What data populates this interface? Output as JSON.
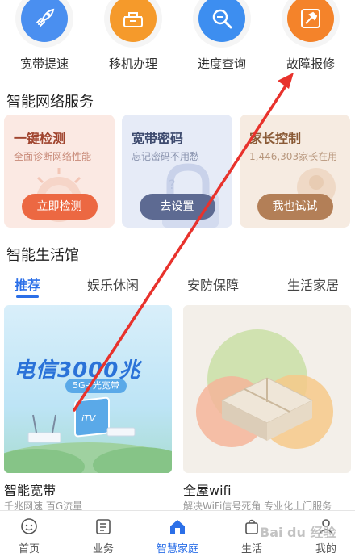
{
  "quick_actions": [
    {
      "label": "宽带提速",
      "icon": "rocket-icon",
      "color": "#4a8ff0"
    },
    {
      "label": "移机办理",
      "icon": "basket-icon",
      "color": "#f59a2b"
    },
    {
      "label": "进度查询",
      "icon": "search-icon",
      "color": "#3d8ef0"
    },
    {
      "label": "故障报修",
      "icon": "hammer-icon",
      "color": "#f4832a"
    }
  ],
  "smart_network": {
    "title": "智能网络服务",
    "cards": [
      {
        "title": "一键检测",
        "subtitle": "全面诊断网络性能",
        "button": "立即检测",
        "icon": "sun-gauge-icon"
      },
      {
        "title": "宽带密码",
        "subtitle": "忘记密码不用愁",
        "button": "去设置",
        "icon": "lock-icon"
      },
      {
        "title": "家长控制",
        "subtitle": "1,446,303家长在用",
        "button": "我也试试",
        "icon": "shield-icon"
      }
    ]
  },
  "smart_life": {
    "title": "智能生活馆",
    "tabs": [
      "推荐",
      "娱乐休闲",
      "安防保障",
      "生活家居"
    ],
    "products": [
      {
        "banner_text": "电信3000兆",
        "badge": "5G+光宽带",
        "screen_text": "iTV",
        "title": "智能宽带",
        "subtitle": "千兆网速 百G流量"
      },
      {
        "title": "全屋wifi",
        "subtitle": "解决WiFi信号死角 专业化上门服务"
      }
    ]
  },
  "bottom_nav": [
    {
      "label": "首页",
      "icon": "home-smile-icon"
    },
    {
      "label": "业务",
      "icon": "list-icon"
    },
    {
      "label": "智慧家庭",
      "icon": "house-icon"
    },
    {
      "label": "生活",
      "icon": "bag-icon"
    },
    {
      "label": "我的",
      "icon": "user-icon"
    }
  ],
  "watermark": "Bai du 经验",
  "colors": {
    "accent": "#2b6fe8",
    "arrow": "#e8322c"
  }
}
